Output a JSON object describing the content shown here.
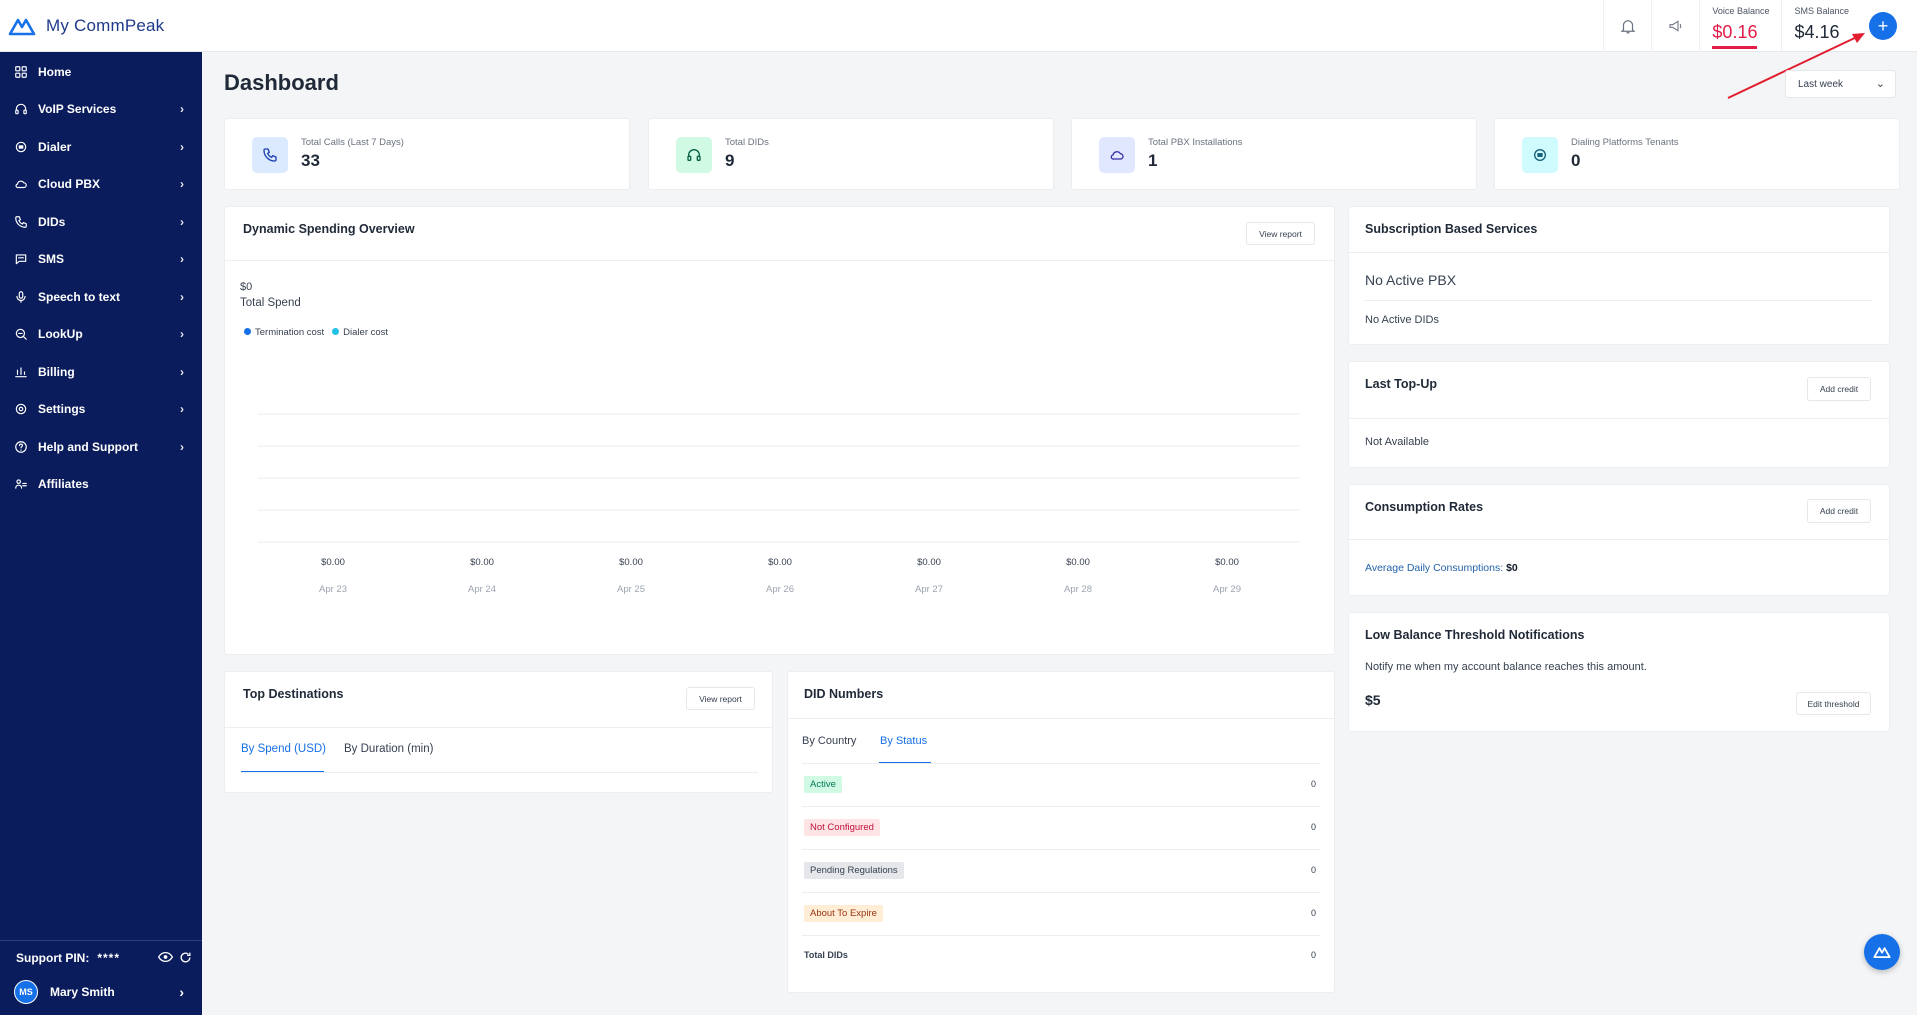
{
  "app": {
    "name": "My CommPeak"
  },
  "topbar": {
    "voice_balance": {
      "label": "Voice Balance",
      "value": "$0.16"
    },
    "sms_balance": {
      "label": "SMS Balance",
      "value": "$4.16"
    },
    "add_label": "+"
  },
  "sidebar": {
    "items": [
      {
        "label": "Home",
        "icon": "grid-icon",
        "has_chevron": false
      },
      {
        "label": "VoIP Services",
        "icon": "headset-icon",
        "has_chevron": true
      },
      {
        "label": "Dialer",
        "icon": "dialer-icon",
        "has_chevron": true
      },
      {
        "label": "Cloud PBX",
        "icon": "cloud-icon",
        "has_chevron": true
      },
      {
        "label": "DIDs",
        "icon": "phone-icon",
        "has_chevron": true
      },
      {
        "label": "SMS",
        "icon": "chat-icon",
        "has_chevron": true
      },
      {
        "label": "Speech to text",
        "icon": "mic-icon",
        "has_chevron": true
      },
      {
        "label": "LookUp",
        "icon": "lookup-icon",
        "has_chevron": true
      },
      {
        "label": "Billing",
        "icon": "billing-icon",
        "has_chevron": true
      },
      {
        "label": "Settings",
        "icon": "gear-icon",
        "has_chevron": true
      },
      {
        "label": "Help and Support",
        "icon": "help-icon",
        "has_chevron": true
      },
      {
        "label": "Affiliates",
        "icon": "affiliates-icon",
        "has_chevron": false
      }
    ],
    "support_pin": {
      "label": "Support PIN:",
      "value": "****"
    },
    "user": {
      "initials": "MS",
      "name": "Mary Smith"
    }
  },
  "page": {
    "title": "Dashboard",
    "range": "Last week"
  },
  "stats": [
    {
      "label": "Total Calls (Last 7 Days)",
      "value": "33",
      "icon": "phone-icon",
      "bg": "#dbeafe",
      "fg": "#1e40af"
    },
    {
      "label": "Total DIDs",
      "value": "9",
      "icon": "headset-icon",
      "bg": "#d1fae5",
      "fg": "#065f46"
    },
    {
      "label": "Total PBX Installations",
      "value": "1",
      "icon": "cloud-icon",
      "bg": "#e0e7ff",
      "fg": "#3730a3"
    },
    {
      "label": "Dialing Platforms Tenants",
      "value": "0",
      "icon": "dialer-icon",
      "bg": "#cffafe",
      "fg": "#155e75"
    }
  ],
  "spending": {
    "title": "Dynamic Spending Overview",
    "view_report": "View report",
    "total_value": "$0",
    "total_label": "Total Spend",
    "legend": [
      {
        "name": "Termination cost",
        "color": "#1670e8"
      },
      {
        "name": "Dialer cost",
        "color": "#22c1e6"
      }
    ]
  },
  "chart_data": {
    "type": "bar",
    "categories": [
      "Apr 23",
      "Apr 24",
      "Apr 25",
      "Apr 26",
      "Apr 27",
      "Apr 28",
      "Apr 29"
    ],
    "series": [
      {
        "name": "Termination cost",
        "values": [
          0,
          0,
          0,
          0,
          0,
          0,
          0
        ]
      },
      {
        "name": "Dialer cost",
        "values": [
          0,
          0,
          0,
          0,
          0,
          0,
          0
        ]
      }
    ],
    "data_labels": [
      "$0.00",
      "$0.00",
      "$0.00",
      "$0.00",
      "$0.00",
      "$0.00",
      "$0.00"
    ],
    "grid": true
  },
  "subscription": {
    "title": "Subscription Based Services",
    "pbx": "No Active PBX",
    "dids": "No Active DIDs"
  },
  "topup": {
    "title": "Last Top-Up",
    "button": "Add credit",
    "value": "Not Available"
  },
  "consumption": {
    "title": "Consumption Rates",
    "button": "Add credit",
    "label": "Average Daily Consumptions:",
    "value": "$0"
  },
  "threshold": {
    "title": "Low Balance Threshold Notifications",
    "description": "Notify me when my account balance reaches this amount.",
    "value": "$5",
    "button": "Edit threshold"
  },
  "destinations": {
    "title": "Top Destinations",
    "view_report": "View report",
    "tabs": [
      "By Spend (USD)",
      "By Duration (min)"
    ]
  },
  "did_numbers": {
    "title": "DID Numbers",
    "tabs": [
      "By Country",
      "By Status"
    ],
    "rows": [
      {
        "label": "Active",
        "count": "0",
        "bg": "#d1fae5",
        "fg": "#047857"
      },
      {
        "label": "Not Configured",
        "count": "0",
        "bg": "#ffe4e6",
        "fg": "#be123c"
      },
      {
        "label": "Pending Regulations",
        "count": "0",
        "bg": "#e5e7eb",
        "fg": "#374151"
      },
      {
        "label": "About To Expire",
        "count": "0",
        "bg": "#ffedd5",
        "fg": "#9a3412"
      }
    ],
    "total_label": "Total DIDs",
    "total_count": "0"
  },
  "colors": {
    "accent": "#1670e8",
    "sidebar": "#0a1c5b",
    "danger": "#e11d48"
  }
}
